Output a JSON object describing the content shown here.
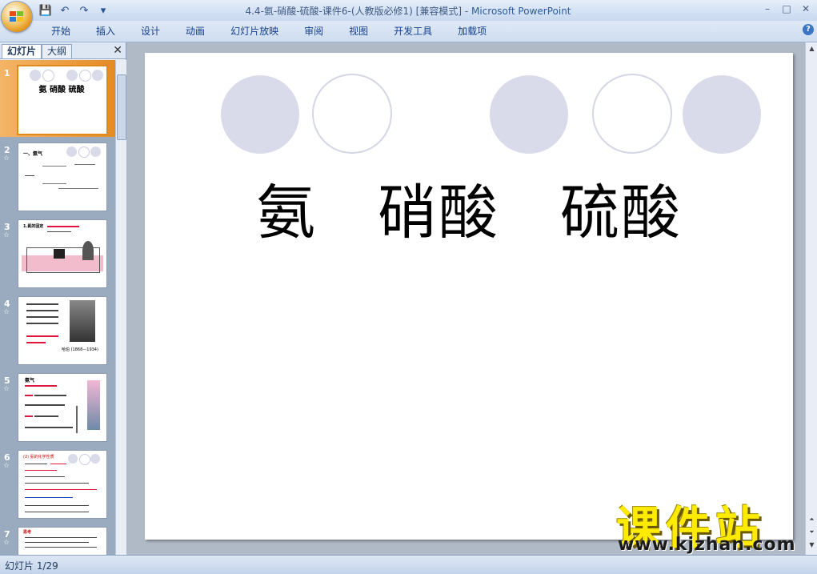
{
  "window": {
    "title_doc": "4.4-氨-硝酸-硫酸-课件6-(人教版必修1) [兼容模式] - ",
    "title_app": "Microsoft PowerPoint",
    "minimize": "–",
    "maximize": "□",
    "close": "✕"
  },
  "qat": {
    "save": "💾",
    "undo": "↶",
    "redo": "↷",
    "more": "▾"
  },
  "ribbon": {
    "tabs": [
      "开始",
      "插入",
      "设计",
      "动画",
      "幻灯片放映",
      "审阅",
      "视图",
      "开发工具",
      "加载项"
    ],
    "help": "?"
  },
  "left_pane": {
    "tab_slides": "幻灯片",
    "tab_outline": "大纲",
    "close": "✕",
    "thumbnails": [
      {
        "number": "1",
        "title": "氨 硝酸 硫酸",
        "selected": true
      },
      {
        "number": "2",
        "title": "一、氨气"
      },
      {
        "number": "3",
        "title": "1.氮的固定"
      },
      {
        "number": "4",
        "caption": "哈伯 (1868—1934)"
      },
      {
        "number": "5",
        "title": "氨气"
      },
      {
        "number": "6",
        "title": "(2) 氨的化学性质"
      },
      {
        "number": "7",
        "title": "思考"
      }
    ],
    "star": "☆"
  },
  "slide": {
    "title": "氨　硝酸　硫酸"
  },
  "watermark": {
    "cn": "课件站",
    "url": "www.kjzhan.com"
  },
  "status": {
    "slide_label": "幻灯片 1/29"
  }
}
